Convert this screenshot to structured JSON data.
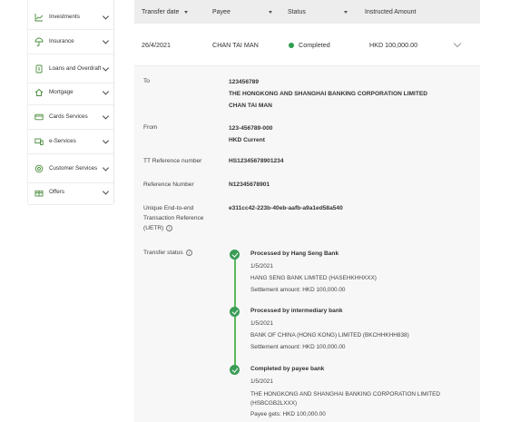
{
  "sidebar": {
    "items": [
      {
        "label": "Investments",
        "icon": "chart-icon"
      },
      {
        "label": "Insurance",
        "icon": "umbrella-icon"
      },
      {
        "label": "Loans and Overdraft",
        "icon": "loan-icon"
      },
      {
        "label": "Mortgage",
        "icon": "house-icon"
      },
      {
        "label": "Cards Services",
        "icon": "card-icon"
      },
      {
        "label": "e-Services",
        "icon": "devices-icon"
      },
      {
        "label": "Customer Services",
        "icon": "support-icon"
      },
      {
        "label": "Offers",
        "icon": "gift-icon"
      }
    ]
  },
  "table": {
    "headers": {
      "transfer_date": "Transfer date",
      "payee": "Payee",
      "status": "Status",
      "amount": "Instructed Amount"
    },
    "row": {
      "date": "26/4/2021",
      "payee": "CHAN TAI MAN",
      "status": "Completed",
      "amount": "HKD 100,000.00"
    }
  },
  "detail": {
    "to_label": "To",
    "to_account": "123456789",
    "to_bank": "THE HONGKONG AND SHANGHAI BANKING CORPORATION LIMITED",
    "to_name": "CHAN TAI MAN",
    "from_label": "From",
    "from_account": "123-456789-000",
    "from_type": "HKD Current",
    "tt_label": "TT Reference number",
    "tt_value": "HS12345678901234",
    "ref_label": "Reference Number",
    "ref_value": "N12345678901",
    "uetr_label_1": "Unique End-to-end",
    "uetr_label_2": "Transaction Reference",
    "uetr_label_3": "(UETR)",
    "uetr_value": "e311cc42-223b-40eb-aafb-a9a1ed58a540",
    "transfer_status_label": "Transfer status"
  },
  "timeline": [
    {
      "title": "Processed by Hang Seng Bank",
      "date": "1/5/2021",
      "bank": "HANG SENG BANK LIMITED (HASEHKHHXXX)",
      "amount": "Settlement amount: HKD 100,000.00"
    },
    {
      "title": "Processed by intermediary bank",
      "date": "1/5/2021",
      "bank": "BANK OF CHINA (HONG KONG) LIMITED (BKCHHKHH838)",
      "amount": "Settlement amount: HKD 100,000.00"
    },
    {
      "title": "Completed by payee bank",
      "date": "1/5/2021",
      "bank": "THE HONGKONG AND SHANGHAI BANKING CORPORATION LIMITED",
      "bank_code": "(HSBCGB2LXXX)",
      "amount": "Payee gets: HKD 100,000.00"
    }
  ],
  "colors": {
    "status_green": "#2e9e4f",
    "panel_bg": "#f7f7f7",
    "header_bg": "#ededed"
  }
}
